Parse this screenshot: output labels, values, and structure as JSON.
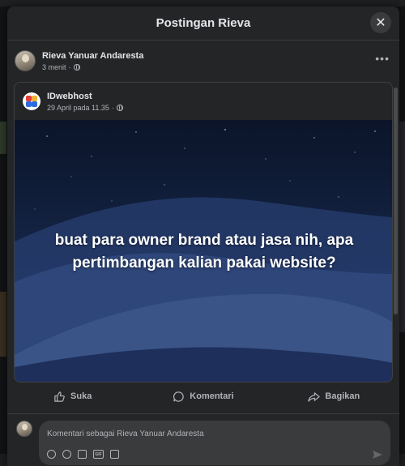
{
  "dialog": {
    "title": "Postingan Rieva",
    "close_symbol": "✕"
  },
  "post": {
    "author": "Rieva Yanuar Andaresta",
    "time": "3 menit",
    "more_symbol": "•••",
    "shared": {
      "page_name": "IDwebhost",
      "time": "29 April pada 11.35",
      "image_text": "buat para owner brand atau jasa nih, apa pertimbangan kalian pakai website?"
    }
  },
  "actions": [
    {
      "label": "Suka",
      "icon": "like-icon"
    },
    {
      "label": "Komentari",
      "icon": "comment-icon"
    },
    {
      "label": "Bagikan",
      "icon": "share-icon"
    }
  ],
  "comment": {
    "placeholder": "Komentari sebagai Rieva Yanuar Andaresta",
    "tools": [
      "avatar-sticker-icon",
      "emoji-icon",
      "camera-icon",
      "gif-icon",
      "sticker-icon"
    ],
    "gif_label": "GIF"
  },
  "colors": {
    "dialog_bg": "#242526",
    "text_primary": "#e4e6eb",
    "text_secondary": "#b0b3b8",
    "image_bg": "#12213f"
  }
}
